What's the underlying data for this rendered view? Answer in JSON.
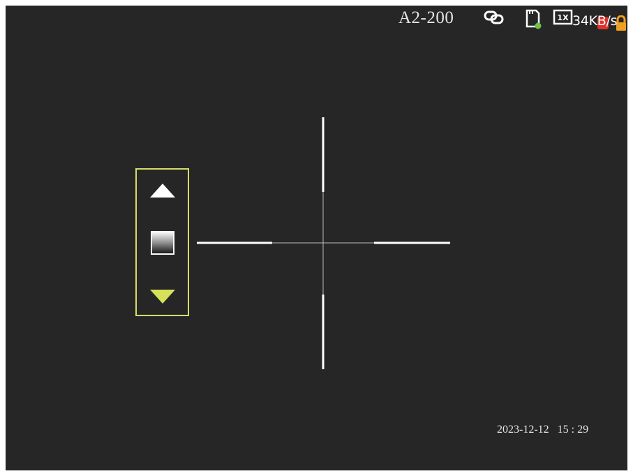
{
  "header": {
    "model": "A2-200",
    "speed": "34KB/s",
    "icons": [
      "link-icon",
      "sd-card-icon",
      "zoom-1x-icon",
      "record-icon",
      "lock-icon"
    ],
    "zoom_text": "1X",
    "sd_status_color": "#6cc24a",
    "record_color": "#e0302a",
    "lock_color": "#f0a020"
  },
  "footer": {
    "datetime": "2023-12-12   15 : 29"
  },
  "control_panel": {
    "border_color": "#d6dc6a",
    "up_color": "#ffffff",
    "down_color": "#d6e15a"
  },
  "colors": {
    "background": "#262626",
    "crosshair": "#ffffff"
  }
}
